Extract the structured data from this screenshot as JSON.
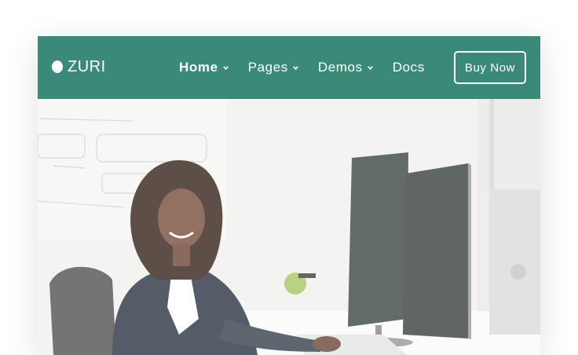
{
  "brand": {
    "name": "ZURI",
    "logo_icon": "circle-logo-icon"
  },
  "nav": {
    "items": [
      {
        "label": "Home",
        "has_dropdown": true,
        "active": true
      },
      {
        "label": "Pages",
        "has_dropdown": true,
        "active": false
      },
      {
        "label": "Demos",
        "has_dropdown": true,
        "active": false
      },
      {
        "label": "Docs",
        "has_dropdown": false,
        "active": false
      }
    ],
    "cta_label": "Buy Now"
  },
  "colors": {
    "navbar_bg": "#3a8a77",
    "text": "#ffffff"
  }
}
